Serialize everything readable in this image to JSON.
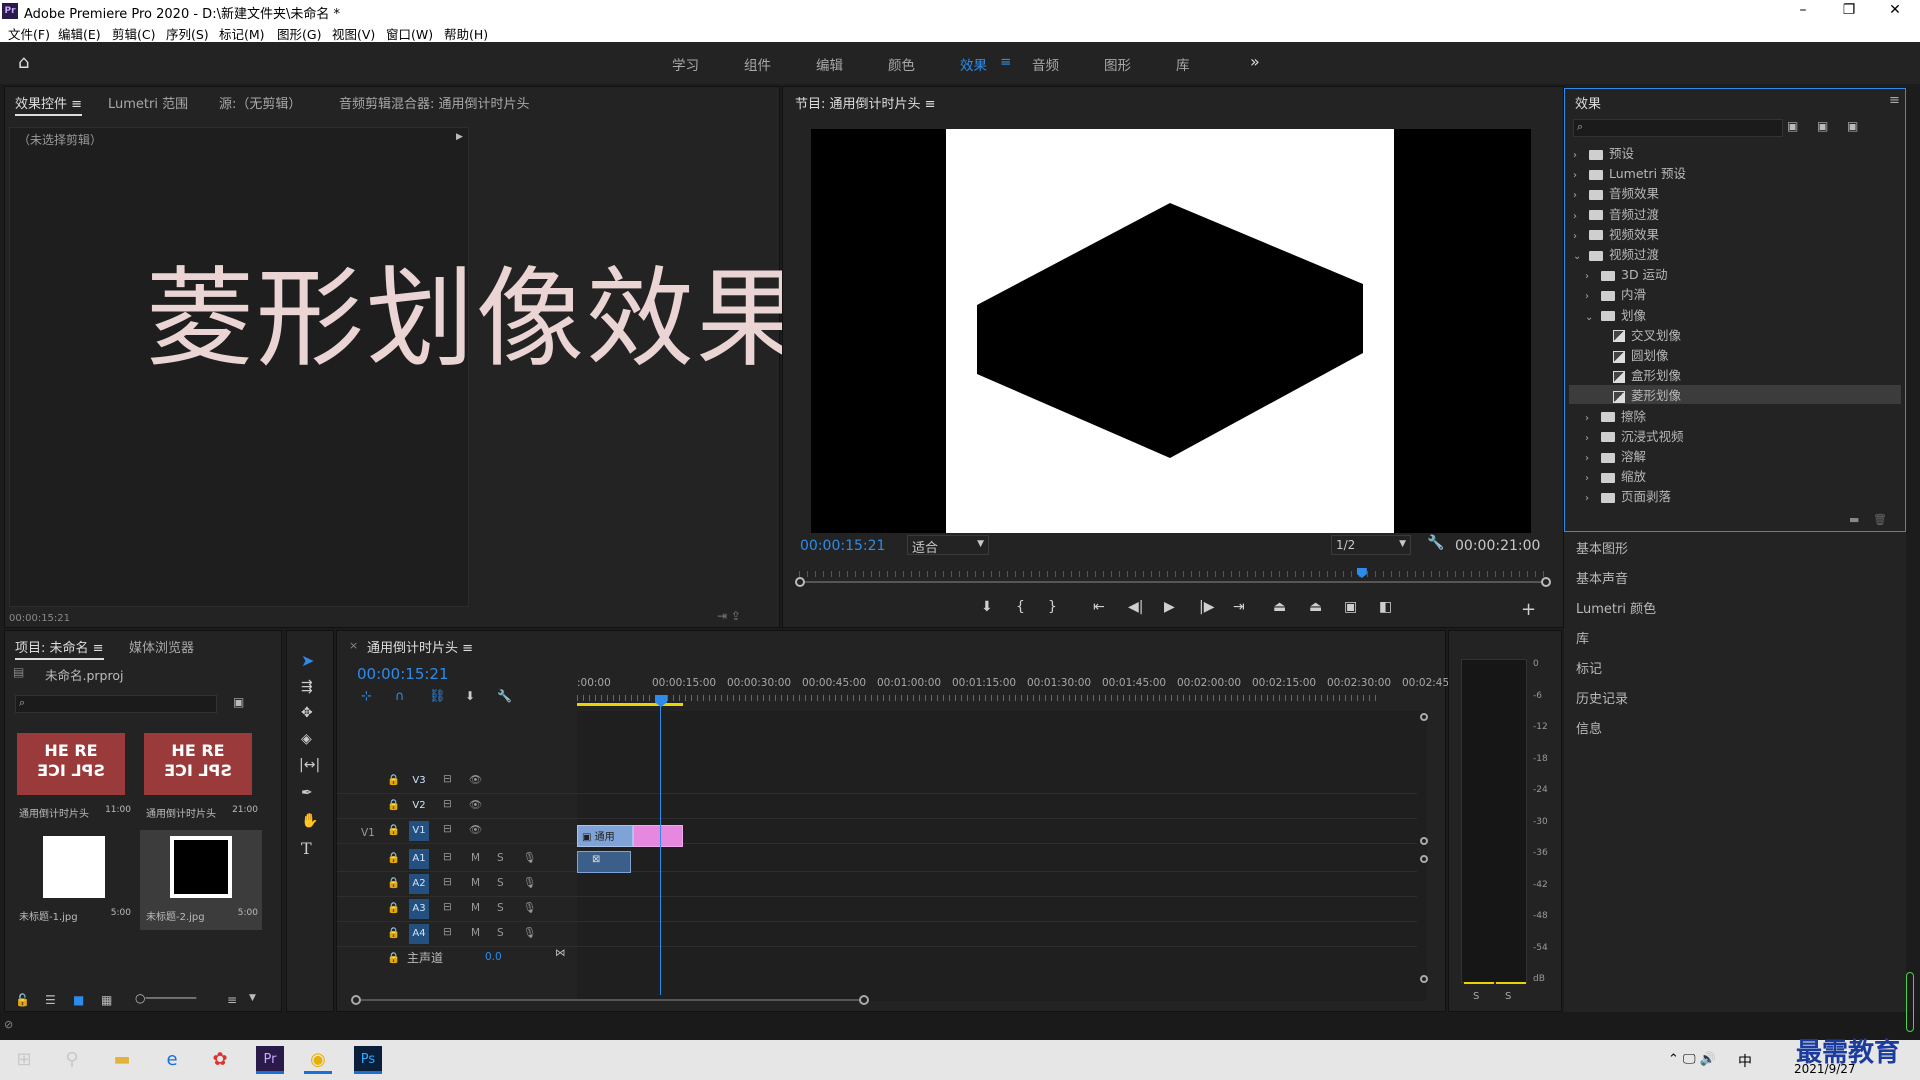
{
  "window": {
    "title": "Adobe Premiere Pro 2020 - D:\\新建文件夹\\未命名 *",
    "logo": "Pr"
  },
  "menu": [
    "文件(F)",
    "编辑(E)",
    "剪辑(C)",
    "序列(S)",
    "标记(M)",
    "图形(G)",
    "视图(V)",
    "窗口(W)",
    "帮助(H)"
  ],
  "workspaces": [
    "学习",
    "组件",
    "编辑",
    "颜色",
    "效果",
    "音频",
    "图形",
    "库"
  ],
  "active_workspace": "效果",
  "source_panel": {
    "tabs": [
      "效果控件",
      "Lumetri 范围",
      "源:（无剪辑）",
      "音频剪辑混合器: 通用倒计时片头"
    ],
    "no_clip": "（未选择剪辑）",
    "timecode": "00:00:15:21"
  },
  "overlay_title": "菱形划像效果",
  "program": {
    "title": "节目: 通用倒计时片头",
    "timecode": "00:00:15:21",
    "fit": "适合",
    "resolution": "1/2",
    "duration": "00:00:21:00",
    "playhead_fraction": 0.7525
  },
  "effects": {
    "title": "效果",
    "tree": [
      {
        "label": "预设",
        "level": 0,
        "type": "folder-star"
      },
      {
        "label": "Lumetri 预设",
        "level": 0,
        "type": "folder-star"
      },
      {
        "label": "音频效果",
        "level": 0,
        "type": "folder"
      },
      {
        "label": "音频过渡",
        "level": 0,
        "type": "folder"
      },
      {
        "label": "视频效果",
        "level": 0,
        "type": "folder"
      },
      {
        "label": "视频过渡",
        "level": 0,
        "type": "folder",
        "open": true
      },
      {
        "label": "3D 运动",
        "level": 1,
        "type": "folder"
      },
      {
        "label": "内滑",
        "level": 1,
        "type": "folder"
      },
      {
        "label": "划像",
        "level": 1,
        "type": "folder",
        "open": true
      },
      {
        "label": "交叉划像",
        "level": 2,
        "type": "fx"
      },
      {
        "label": "圆划像",
        "level": 2,
        "type": "fx"
      },
      {
        "label": "盒形划像",
        "level": 2,
        "type": "fx"
      },
      {
        "label": "菱形划像",
        "level": 2,
        "type": "fx",
        "selected": true
      },
      {
        "label": "擦除",
        "level": 1,
        "type": "folder"
      },
      {
        "label": "沉浸式视频",
        "level": 1,
        "type": "folder"
      },
      {
        "label": "溶解",
        "level": 1,
        "type": "folder"
      },
      {
        "label": "缩放",
        "level": 1,
        "type": "folder"
      },
      {
        "label": "页面剥落",
        "level": 1,
        "type": "folder"
      }
    ]
  },
  "side_panels": [
    "基本图形",
    "基本声音",
    "Lumetri 颜色",
    "库",
    "标记",
    "历史记录",
    "信息"
  ],
  "project": {
    "tabs": [
      "项目: 未命名",
      "媒体浏览器"
    ],
    "file": "未命名.prproj",
    "items": [
      {
        "name": "通用倒计时片头",
        "duration": "11:00",
        "thumb": "splice"
      },
      {
        "name": "通用倒计时片头",
        "duration": "21:00",
        "thumb": "splice"
      },
      {
        "name": "未标题-1.jpg",
        "duration": "5:00",
        "thumb": "white"
      },
      {
        "name": "未标题-2.jpg",
        "duration": "5:00",
        "thumb": "black",
        "selected": true
      }
    ],
    "splice_text_top": "HE RE",
    "splice_text_bottom": "SPL ICE"
  },
  "timeline": {
    "title": "通用倒计时片头",
    "timecode": "00:00:15:21",
    "ruler": [
      ":00:00",
      "00:00:15:00",
      "00:00:30:00",
      "00:00:45:00",
      "00:01:00:00",
      "00:01:15:00",
      "00:01:30:00",
      "00:01:45:00",
      "00:02:00:00",
      "00:02:15:00",
      "00:02:30:00",
      "00:02:45:"
    ],
    "video_tracks": [
      "V3",
      "V2",
      "V1"
    ],
    "audio_tracks": [
      "A1",
      "A2",
      "A3",
      "A4"
    ],
    "source_patch": "V1",
    "master": "主声道",
    "master_value": "0.0",
    "clip_label": "通用",
    "m": "M",
    "s": "S"
  },
  "meter": {
    "labels": [
      "0",
      "-6",
      "-12",
      "-18",
      "-24",
      "-30",
      "-36",
      "-42",
      "-48",
      "-54",
      "dB"
    ],
    "solo": [
      "S",
      "S"
    ]
  },
  "taskbar": {
    "time": "2021/9/27",
    "ime": "中",
    "watermark": "最需教育"
  },
  "colors": {
    "accent": "#2d8ceb",
    "v_clip": "#7fa3d6",
    "transition": "#e688e0",
    "selected_item": "#3c3c3c"
  }
}
